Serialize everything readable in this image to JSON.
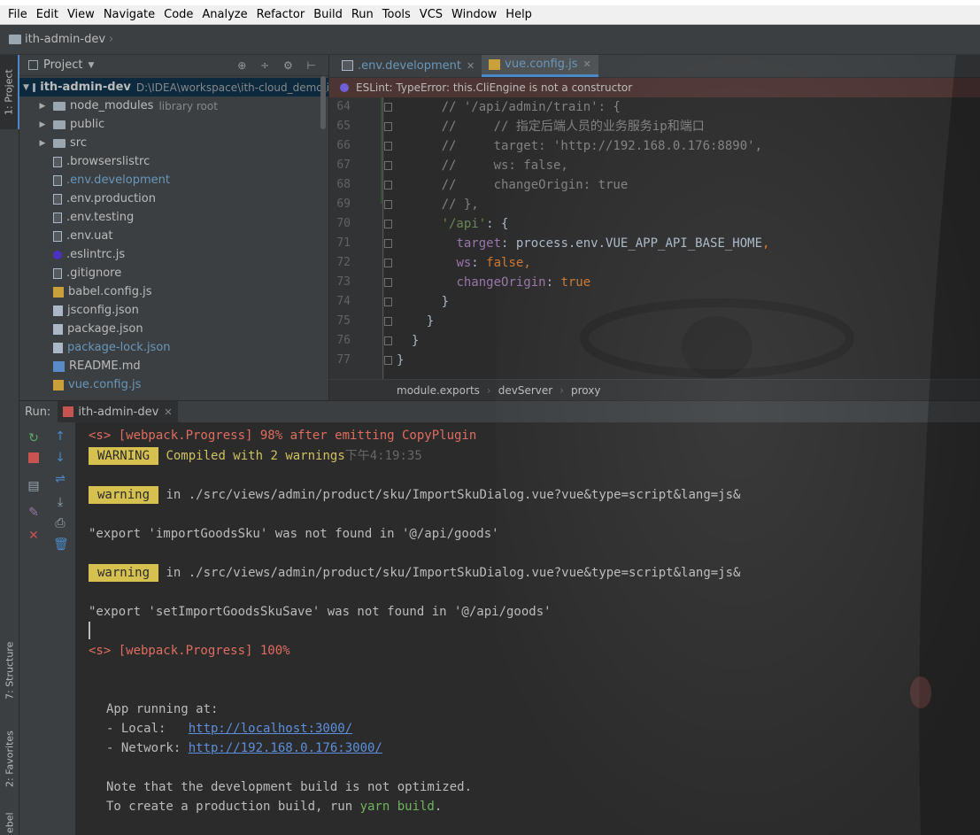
{
  "menu": [
    "File",
    "Edit",
    "View",
    "Navigate",
    "Code",
    "Analyze",
    "Refactor",
    "Build",
    "Run",
    "Tools",
    "VCS",
    "Window",
    "Help"
  ],
  "navbar": {
    "project_name": "ith-admin-dev"
  },
  "left_strip": {
    "project_tab": "1: Project",
    "structure_tab": "7: Structure",
    "favorites_tab": "2: Favorites",
    "rebel_tab": "ebel"
  },
  "project_panel": {
    "title": "Project",
    "root": {
      "name": "ith-admin-dev",
      "path": "D:\\IDEA\\workspace\\ith-cloud_demo\\i"
    },
    "items": [
      {
        "name": "node_modules",
        "extra": "library root",
        "type": "folder"
      },
      {
        "name": "public",
        "type": "folder"
      },
      {
        "name": "src",
        "type": "folder"
      },
      {
        "name": ".browserslistrc",
        "type": "file"
      },
      {
        "name": ".env.development",
        "type": "file"
      },
      {
        "name": ".env.production",
        "type": "file"
      },
      {
        "name": ".env.testing",
        "type": "file"
      },
      {
        "name": ".env.uat",
        "type": "file"
      },
      {
        "name": ".eslintrc.js",
        "type": "eslint"
      },
      {
        "name": ".gitignore",
        "type": "file"
      },
      {
        "name": "babel.config.js",
        "type": "js"
      },
      {
        "name": "jsconfig.json",
        "type": "json"
      },
      {
        "name": "package.json",
        "type": "json"
      },
      {
        "name": "package-lock.json",
        "type": "json"
      },
      {
        "name": "README.md",
        "type": "md"
      },
      {
        "name": "vue.config.js",
        "type": "js"
      }
    ]
  },
  "editor": {
    "tabs": [
      {
        "label": ".env.development",
        "active": false
      },
      {
        "label": "vue.config.js",
        "active": true
      }
    ],
    "eslint_message": "ESLint: TypeError: this.CliEngine is not a constructor",
    "lines": [
      {
        "num": "64",
        "text": "      // '/api/admin/train': {"
      },
      {
        "num": "65",
        "text": "      //     // 指定后端人员的业务服务ip和端口"
      },
      {
        "num": "66",
        "text": "      //     target: 'http://192.168.0.176:8890',"
      },
      {
        "num": "67",
        "text": "      //     ws: false,"
      },
      {
        "num": "68",
        "text": "      //     changeOrigin: true"
      },
      {
        "num": "69",
        "text": "      // },"
      },
      {
        "num": "70",
        "text": "      '/api': {"
      },
      {
        "num": "71",
        "text": "        target: process.env.VUE_APP_API_BASE_HOME,"
      },
      {
        "num": "72",
        "text": "        ws: false,"
      },
      {
        "num": "73",
        "text": "        changeOrigin: true"
      },
      {
        "num": "74",
        "text": "      }"
      },
      {
        "num": "75",
        "text": "    }"
      },
      {
        "num": "76",
        "text": "  }"
      },
      {
        "num": "77",
        "text": "}"
      }
    ],
    "breadcrumb": [
      "module.exports",
      "devServer",
      "proxy"
    ]
  },
  "run_panel": {
    "label": "Run:",
    "tab": "ith-admin-dev",
    "console": {
      "progress_98": "<s> [webpack.Progress] 98% after emitting CopyPlugin",
      "warning_badge": "WARNING",
      "compiled": "Compiled with 2 warnings",
      "time": "下午4:19:35",
      "warning_small": "warning",
      "warn1_path": "in ./src/views/admin/product/sku/ImportSkuDialog.vue?vue&type=script&lang=js&",
      "warn1_msg": "\"export 'importGoodsSku' was not found in '@/api/goods'",
      "warn2_path": "in ./src/views/admin/product/sku/ImportSkuDialog.vue?vue&type=script&lang=js&",
      "warn2_msg": "\"export 'setImportGoodsSkuSave' was not found in '@/api/goods'",
      "progress_100": "<s> [webpack.Progress] 100%",
      "app_running": "App running at:",
      "local_label": "- Local:   ",
      "local_url": "http://localhost:3000/",
      "network_label": "- Network: ",
      "network_url": "http://192.168.0.176:3000/",
      "note": "Note that the development build is not optimized.",
      "build_prefix": "To create a production build, run ",
      "build_cmd": "yarn build",
      "build_suffix": "."
    }
  },
  "colors": {
    "accent": "#4a88c7",
    "error_bar": "#4d3534",
    "warning_badge": "#d6c150",
    "console_red": "#e06c5f"
  }
}
